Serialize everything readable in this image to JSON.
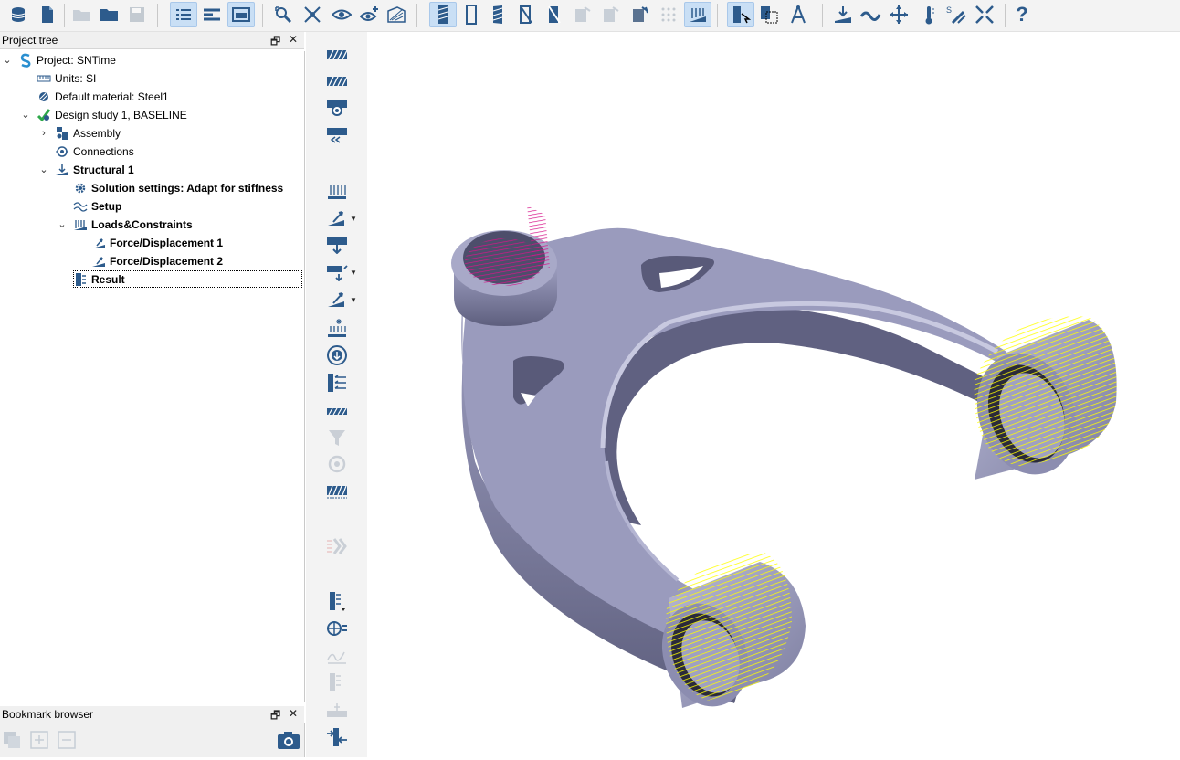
{
  "toolbar": {
    "icons": [
      "database-icon",
      "new-document-icon",
      "open-folder-icon",
      "folder-icon",
      "save-icon",
      "tree-list-icon",
      "split-view-icon",
      "display-mode-icon",
      "zoom-fit-icon",
      "cross-section-icon",
      "eye-view-icon",
      "eye-add-icon",
      "view-plane-icon",
      "hatch-body-icon",
      "outline-body-icon",
      "hatch-slant-icon",
      "hatch-cut-icon",
      "hatch-mirror-icon",
      "gray-tool-a-icon",
      "gray-tool-b-icon",
      "gray-tool-c-icon",
      "grid-dots-icon",
      "mesh-load-icon",
      "select-cursor-icon",
      "select-box-icon",
      "compass-icon",
      "load-down-icon",
      "load-wave-icon",
      "load-move-icon",
      "thermometer-icon",
      "stress-icon",
      "shrink-icon",
      "help-icon"
    ],
    "help_label": "?"
  },
  "project_tree": {
    "title": "Project tree",
    "restore_glyph": "🗗",
    "close_glyph": "✕",
    "nodes": [
      {
        "label": "Project: SNTime",
        "icon": "project-s-icon",
        "bold": false
      },
      {
        "label": "Units: SI",
        "icon": "ruler-icon",
        "bold": false
      },
      {
        "label": "Default material: Steel1",
        "icon": "material-icon",
        "bold": false
      },
      {
        "label": "Design study 1, BASELINE",
        "icon": "design-study-icon",
        "bold": false
      },
      {
        "label": "Assembly",
        "icon": "assembly-icon",
        "bold": false
      },
      {
        "label": "Connections",
        "icon": "connections-icon",
        "bold": false
      },
      {
        "label": "Structural  1",
        "icon": "structural-icon",
        "bold": true
      },
      {
        "label": "Solution settings: Adapt for stiffness",
        "icon": "gear-icon",
        "bold": true
      },
      {
        "label": "Setup",
        "icon": "setup-wave-icon",
        "bold": true
      },
      {
        "label": "Loads&Constraints",
        "icon": "loads-icon",
        "bold": true
      },
      {
        "label": "Force/Displacement 1",
        "icon": "force-icon",
        "bold": true
      },
      {
        "label": "Force/Displacement 2",
        "icon": "force-icon",
        "bold": true
      },
      {
        "label": "Result",
        "icon": "result-icon",
        "bold": true
      }
    ]
  },
  "bookmark_browser": {
    "title": "Bookmark browser",
    "restore_glyph": "🗗",
    "close_glyph": "✕"
  },
  "colors": {
    "part": "#9a9bbd",
    "force_pink": "#d6148a",
    "constraint_yellow": "#ffff00",
    "icon_blue": "#2d5b8c"
  }
}
